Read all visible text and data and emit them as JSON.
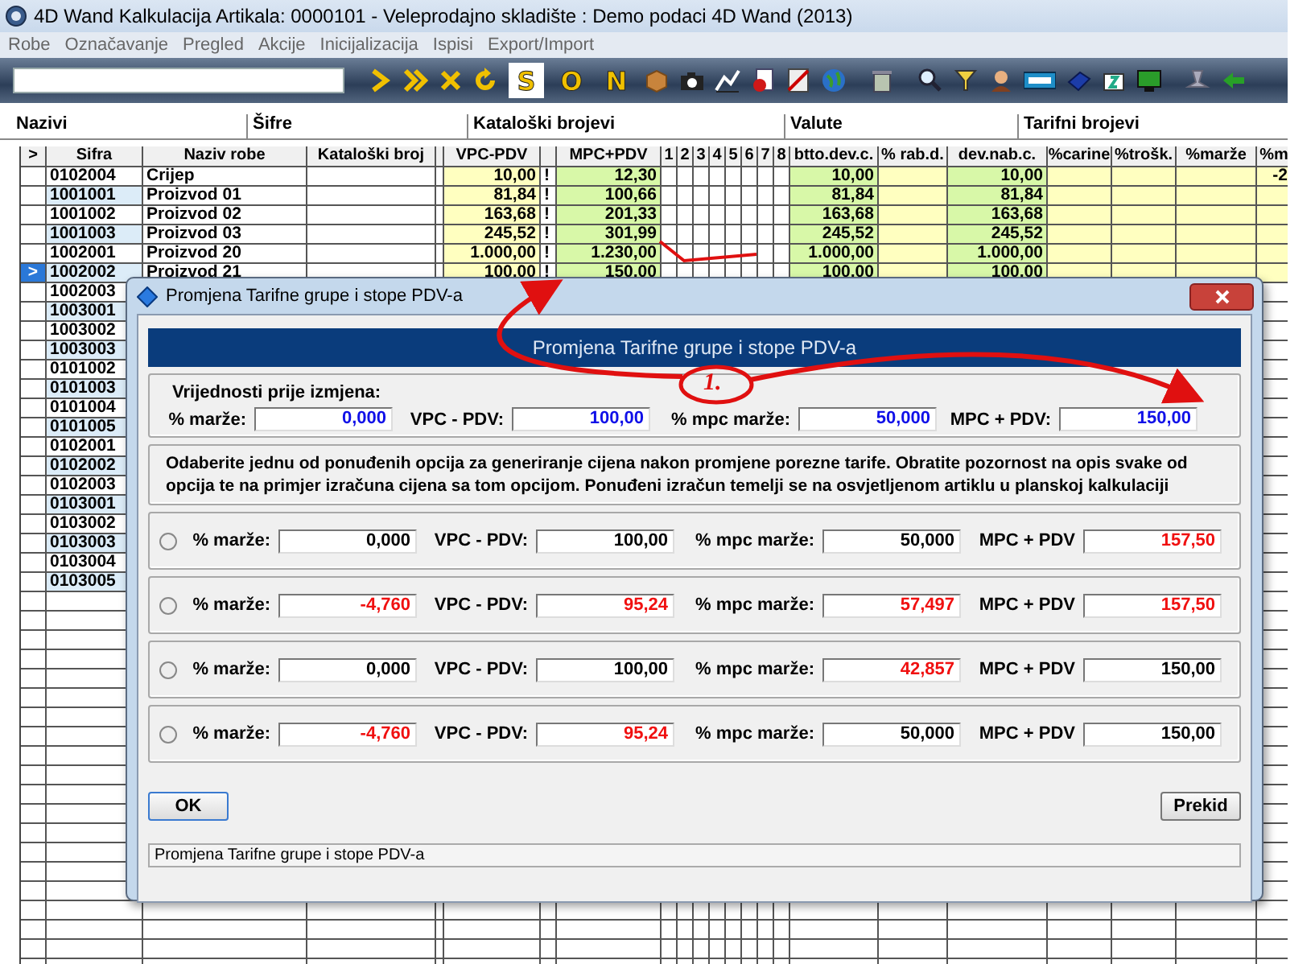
{
  "window": {
    "title": "4D Wand Kalkulacija Artikala: 0000101 - Veleprodajno skladište : Demo podaci 4D Wand (2013)"
  },
  "menu": [
    "Robe",
    "Označavanje",
    "Pregled",
    "Akcije",
    "Inicijalizacija",
    "Ispisi",
    "Export/Import"
  ],
  "toolbar": {
    "letter_buttons": [
      {
        "label": "S",
        "selected": true
      },
      {
        "label": "O",
        "selected": false
      },
      {
        "label": "N",
        "selected": false
      }
    ]
  },
  "tabs": [
    {
      "label": "Nazivi",
      "selected": true
    },
    {
      "label": "Šifre",
      "selected": false
    },
    {
      "label": "Kataloški brojevi",
      "selected": false
    },
    {
      "label": "Valute",
      "selected": false
    },
    {
      "label": "Tarifni brojevi",
      "selected": false
    }
  ],
  "table": {
    "marker_header": ">",
    "columns": [
      {
        "kind": "sifra",
        "label": "Sifra"
      },
      {
        "kind": "naziv",
        "label": "Naziv robe"
      },
      {
        "kind": "kat",
        "label": "Kataloški broj"
      },
      {
        "kind": "gap"
      },
      {
        "kind": "vpc",
        "label": "VPC-PDV"
      },
      {
        "kind": "flag"
      },
      {
        "kind": "mpc",
        "label": "MPC+PDV"
      },
      {
        "kind": "num",
        "label": "1"
      },
      {
        "kind": "num",
        "label": "2"
      },
      {
        "kind": "num",
        "label": "3"
      },
      {
        "kind": "num",
        "label": "4"
      },
      {
        "kind": "num",
        "label": "5"
      },
      {
        "kind": "num",
        "label": "6"
      },
      {
        "kind": "num",
        "label": "7"
      },
      {
        "kind": "num",
        "label": "8"
      },
      {
        "kind": "btto",
        "label": "btto.dev.c."
      },
      {
        "kind": "rab",
        "label": "% rab.d."
      },
      {
        "kind": "devnab",
        "label": "dev.nab.c."
      },
      {
        "kind": "carine",
        "label": "%carine"
      },
      {
        "kind": "trosk",
        "label": "%trošk."
      },
      {
        "kind": "marze",
        "label": "%marže"
      },
      {
        "kind": "m",
        "label": "%m"
      }
    ],
    "rows": [
      {
        "selected": false,
        "sifra": "0102004",
        "naziv": "Crijep",
        "vpc": "10,00",
        "flag": "!",
        "mpc": "12,30",
        "btto": "10,00",
        "devnab": "10,00",
        "m": "-2"
      },
      {
        "selected": false,
        "sifra": "1001001",
        "naziv": "Proizvod 01",
        "vpc": "81,84",
        "flag": "!",
        "mpc": "100,66",
        "btto": "81,84",
        "devnab": "81,84"
      },
      {
        "selected": false,
        "sifra": "1001002",
        "naziv": "Proizvod 02",
        "vpc": "163,68",
        "flag": "!",
        "mpc": "201,33",
        "btto": "163,68",
        "devnab": "163,68"
      },
      {
        "selected": false,
        "sifra": "1001003",
        "naziv": "Proizvod 03",
        "vpc": "245,52",
        "flag": "!",
        "mpc": "301,99",
        "btto": "245,52",
        "devnab": "245,52"
      },
      {
        "selected": false,
        "sifra": "1002001",
        "naziv": "Proizvod 20",
        "vpc": "1.000,00",
        "flag": "!",
        "mpc": "1.230,00",
        "btto": "1.000,00",
        "devnab": "1.000,00"
      },
      {
        "selected": true,
        "marker": ">",
        "sifra": "1002002",
        "naziv": "Proizvod 21",
        "vpc": "100,00",
        "flag": "!",
        "mpc": "150,00",
        "btto": "100,00",
        "devnab": "100,00"
      },
      {
        "selected": false,
        "sifra": "1002003"
      },
      {
        "selected": false,
        "sifra": "1003001"
      },
      {
        "selected": false,
        "sifra": "1003002"
      },
      {
        "selected": false,
        "sifra": "1003003"
      },
      {
        "selected": false,
        "sifra": "0101002"
      },
      {
        "selected": false,
        "sifra": "0101003"
      },
      {
        "selected": false,
        "sifra": "0101004"
      },
      {
        "selected": false,
        "sifra": "0101005"
      },
      {
        "selected": false,
        "sifra": "0102001"
      },
      {
        "selected": false,
        "sifra": "0102002"
      },
      {
        "selected": false,
        "sifra": "0102003"
      },
      {
        "selected": false,
        "sifra": "0103001"
      },
      {
        "selected": false,
        "sifra": "0103002"
      },
      {
        "selected": false,
        "sifra": "0103003"
      },
      {
        "selected": false,
        "sifra": "0103004"
      },
      {
        "selected": false,
        "sifra": "0103005"
      }
    ]
  },
  "dialog": {
    "title": "Promjena Tarifne grupe i stope PDV-a",
    "banner": "Promjena Tarifne grupe i stope PDV-a",
    "before": {
      "heading": "Vrijednosti prije izmjena:",
      "fields": [
        {
          "label": "% marže:",
          "value": "0,000"
        },
        {
          "label": "VPC - PDV:",
          "value": "100,00"
        },
        {
          "label": "% mpc marže:",
          "value": "50,000"
        },
        {
          "label": "MPC + PDV:",
          "value": "150,00"
        }
      ]
    },
    "instructions": "Odaberite jednu od ponuđenih opcija za generiranje cijena nakon promjene porezne tarife. Obratite pozornost na opis svake od opcija te na primjer izračuna cijena sa tom opcijom. Ponuđeni izračun temelji se na osvjetljenom artiklu u planskoj kalkulaciji",
    "options": [
      {
        "selected": false,
        "fields": [
          {
            "label": "% marže:",
            "value": "0,000",
            "changed": false
          },
          {
            "label": "VPC - PDV:",
            "value": "100,00",
            "changed": false
          },
          {
            "label": "% mpc marže:",
            "value": "50,000",
            "changed": false
          },
          {
            "label": "MPC + PDV",
            "value": "157,50",
            "changed": true
          }
        ]
      },
      {
        "selected": false,
        "fields": [
          {
            "label": "% marže:",
            "value": "-4,760",
            "changed": true
          },
          {
            "label": "VPC - PDV:",
            "value": "95,24",
            "changed": true
          },
          {
            "label": "% mpc marže:",
            "value": "57,497",
            "changed": true
          },
          {
            "label": "MPC + PDV",
            "value": "157,50",
            "changed": true
          }
        ]
      },
      {
        "selected": false,
        "fields": [
          {
            "label": "% marže:",
            "value": "0,000",
            "changed": false
          },
          {
            "label": "VPC - PDV:",
            "value": "100,00",
            "changed": false
          },
          {
            "label": "% mpc marže:",
            "value": "42,857",
            "changed": true
          },
          {
            "label": "MPC + PDV",
            "value": "150,00",
            "changed": false
          }
        ]
      },
      {
        "selected": false,
        "fields": [
          {
            "label": "% marže:",
            "value": "-4,760",
            "changed": true
          },
          {
            "label": "VPC - PDV:",
            "value": "95,24",
            "changed": true
          },
          {
            "label": "% mpc marže:",
            "value": "50,000",
            "changed": false
          },
          {
            "label": "MPC + PDV",
            "value": "150,00",
            "changed": false
          }
        ]
      }
    ],
    "ok": "OK",
    "cancel": "Prekid",
    "status": "Promjena Tarifne grupe i stope PDV-a"
  },
  "annotation": {
    "label": "1."
  }
}
